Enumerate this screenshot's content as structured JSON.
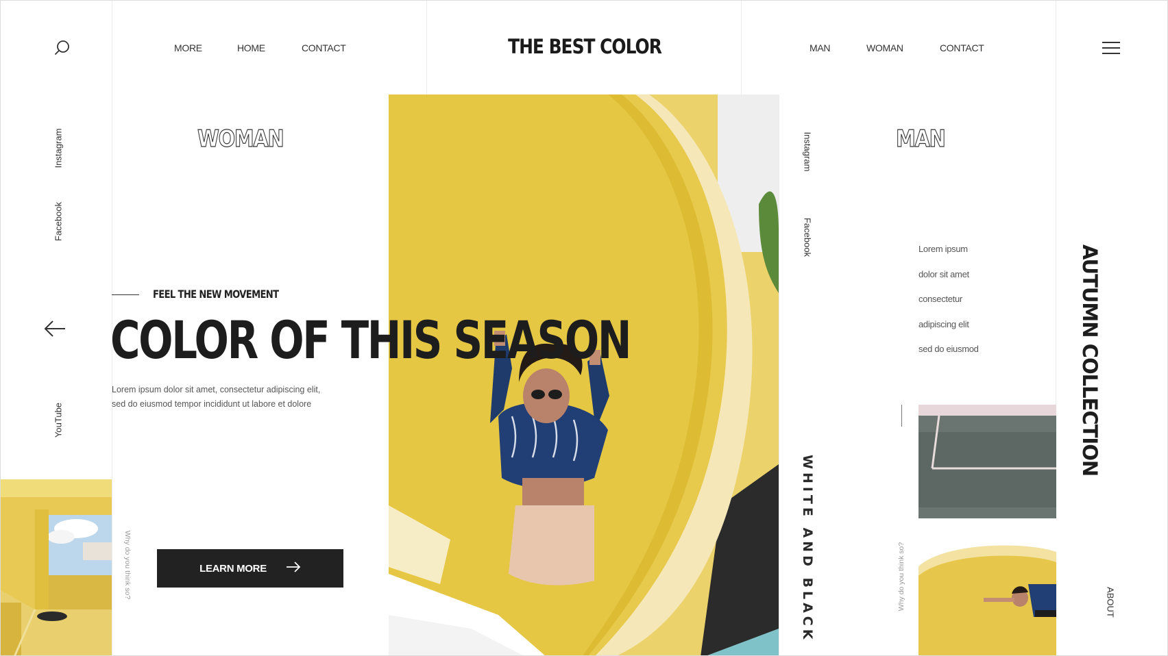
{
  "header": {
    "brand": "THE BEST COLOR",
    "nav_left": [
      "MORE",
      "HOME",
      "CONTACT"
    ],
    "nav_right": [
      "MAN",
      "WOMAN",
      "CONTACT"
    ]
  },
  "left_rail": {
    "social": [
      "Instagram",
      "Facebook",
      "YouTube"
    ],
    "question": "Why do you think so?"
  },
  "woman_section": {
    "label": "WOMAN",
    "tagline": "FEEL THE NEW MOVEMENT",
    "headline": "COLOR OF THIS SEASON",
    "lead_line1": "Lorem ipsum dolor sit amet, consectetur adipiscing elit,",
    "lead_line2": "sed do eiusmod tempor incididunt ut labore et dolore",
    "cta_label": "LEARN MORE"
  },
  "center_rail": {
    "social": [
      "Instagram",
      "Facebook"
    ],
    "caption": "WHITE AND BLACK"
  },
  "man_section": {
    "label": "MAN",
    "list": [
      "Lorem ipsum",
      "dolor sit amet",
      "consectetur",
      "adipiscing elit",
      "sed do eiusmod"
    ],
    "question": "Why do you think so?"
  },
  "right_rail": {
    "collection": "AUTUMN COLLECTION",
    "about": "ABOUT"
  },
  "icons": {
    "search": "search-icon",
    "menu": "hamburger-menu-icon",
    "back": "arrow-left-icon",
    "cta_arrow": "arrow-right-icon"
  },
  "colors": {
    "ink": "#1d1d1d",
    "button": "#222222",
    "yellow": "#e9c94e",
    "cream": "#f4e3b3"
  }
}
